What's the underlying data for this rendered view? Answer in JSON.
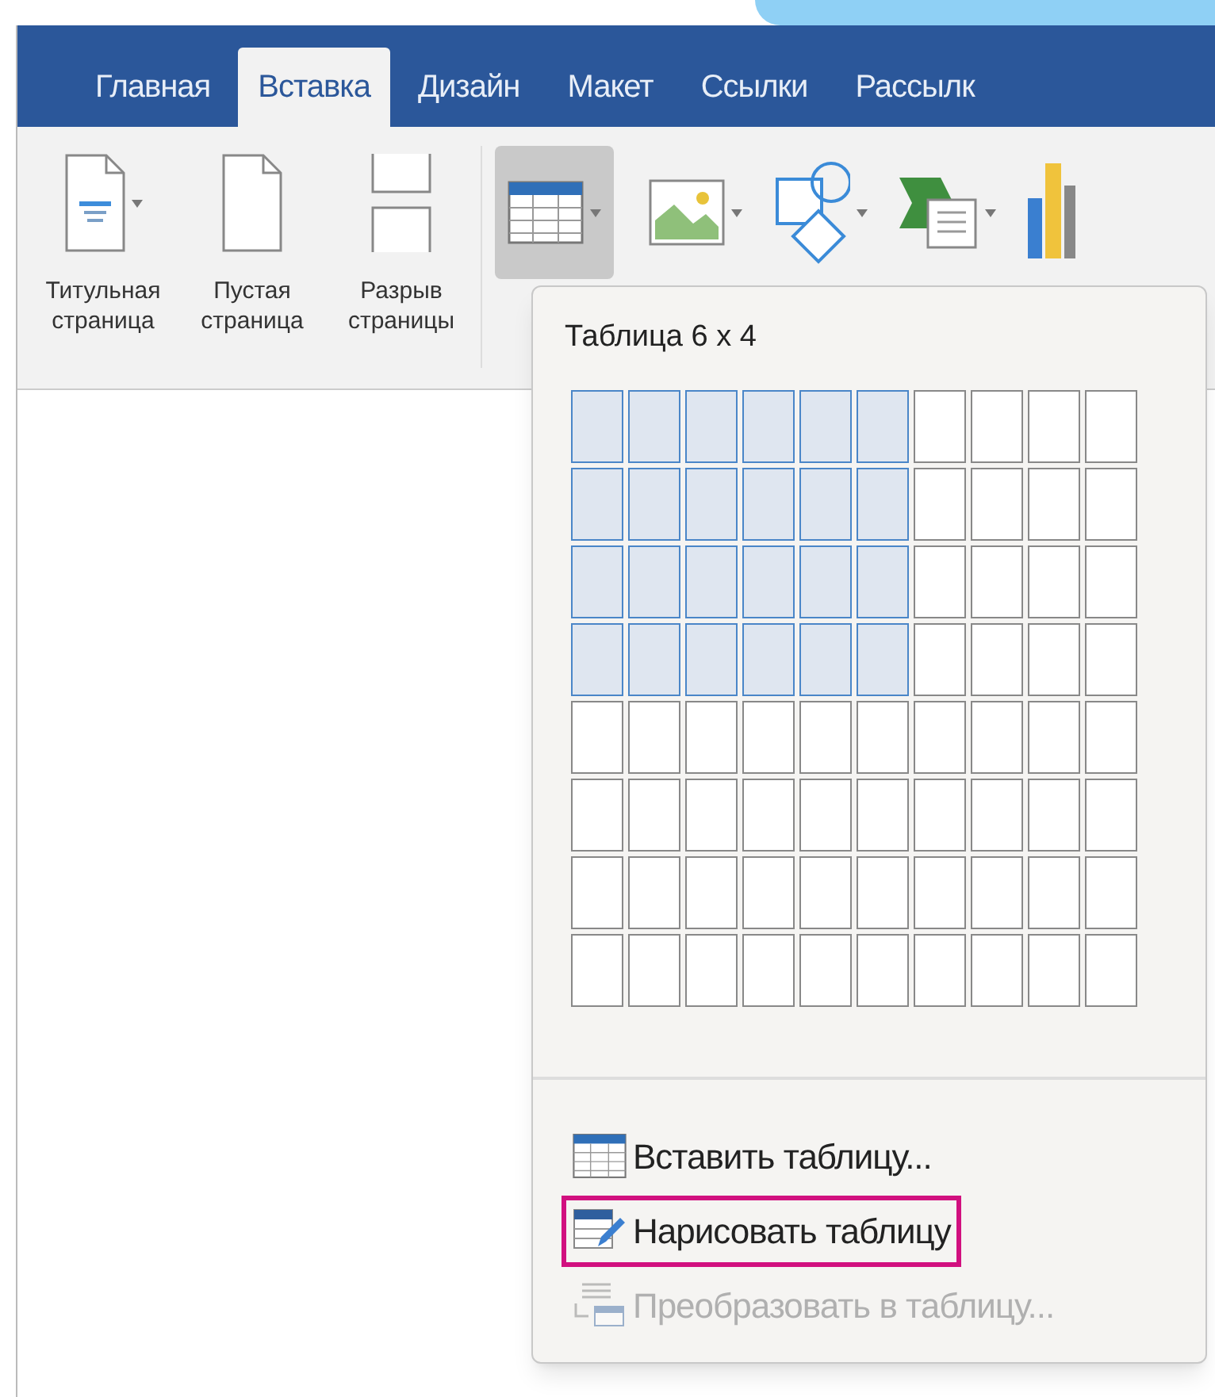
{
  "tabs": [
    {
      "label": "Главная",
      "selected": false
    },
    {
      "label": "Вставка",
      "selected": true
    },
    {
      "label": "Дизайн",
      "selected": false
    },
    {
      "label": "Макет",
      "selected": false
    },
    {
      "label": "Ссылки",
      "selected": false
    },
    {
      "label": "Рассылк",
      "selected": false
    }
  ],
  "ribbon": {
    "page_buttons": [
      {
        "kind": "cover",
        "line1": "Титульная",
        "line2": "страница",
        "dropdown": true
      },
      {
        "kind": "blank",
        "line1": "Пустая",
        "line2": "страница",
        "dropdown": false
      },
      {
        "kind": "break",
        "line1": "Разрыв",
        "line2": "страницы",
        "dropdown": false
      }
    ],
    "icon_buttons": [
      {
        "kind": "table",
        "selected": true,
        "dropdown": true
      },
      {
        "kind": "picture",
        "selected": false,
        "dropdown": true
      },
      {
        "kind": "shapes",
        "selected": false,
        "dropdown": true
      },
      {
        "kind": "smartart",
        "selected": false,
        "dropdown": true
      },
      {
        "kind": "chart",
        "selected": false,
        "dropdown": false
      }
    ]
  },
  "table_menu": {
    "title": "Таблица 6 x 4",
    "grid_rows": [
      {
        "cells": [
          {
            "selected": true
          },
          {
            "selected": true
          },
          {
            "selected": true
          },
          {
            "selected": true
          },
          {
            "selected": true
          },
          {
            "selected": true
          },
          {
            "selected": false
          },
          {
            "selected": false
          },
          {
            "selected": false
          },
          {
            "selected": false
          }
        ]
      },
      {
        "cells": [
          {
            "selected": true
          },
          {
            "selected": true
          },
          {
            "selected": true
          },
          {
            "selected": true
          },
          {
            "selected": true
          },
          {
            "selected": true
          },
          {
            "selected": false
          },
          {
            "selected": false
          },
          {
            "selected": false
          },
          {
            "selected": false
          }
        ]
      },
      {
        "cells": [
          {
            "selected": true
          },
          {
            "selected": true
          },
          {
            "selected": true
          },
          {
            "selected": true
          },
          {
            "selected": true
          },
          {
            "selected": true
          },
          {
            "selected": false
          },
          {
            "selected": false
          },
          {
            "selected": false
          },
          {
            "selected": false
          }
        ]
      },
      {
        "cells": [
          {
            "selected": true
          },
          {
            "selected": true
          },
          {
            "selected": true
          },
          {
            "selected": true
          },
          {
            "selected": true
          },
          {
            "selected": true
          },
          {
            "selected": false
          },
          {
            "selected": false
          },
          {
            "selected": false
          },
          {
            "selected": false
          }
        ]
      },
      {
        "cells": [
          {
            "selected": false
          },
          {
            "selected": false
          },
          {
            "selected": false
          },
          {
            "selected": false
          },
          {
            "selected": false
          },
          {
            "selected": false
          },
          {
            "selected": false
          },
          {
            "selected": false
          },
          {
            "selected": false
          },
          {
            "selected": false
          }
        ]
      },
      {
        "cells": [
          {
            "selected": false
          },
          {
            "selected": false
          },
          {
            "selected": false
          },
          {
            "selected": false
          },
          {
            "selected": false
          },
          {
            "selected": false
          },
          {
            "selected": false
          },
          {
            "selected": false
          },
          {
            "selected": false
          },
          {
            "selected": false
          }
        ]
      },
      {
        "cells": [
          {
            "selected": false
          },
          {
            "selected": false
          },
          {
            "selected": false
          },
          {
            "selected": false
          },
          {
            "selected": false
          },
          {
            "selected": false
          },
          {
            "selected": false
          },
          {
            "selected": false
          },
          {
            "selected": false
          },
          {
            "selected": false
          }
        ]
      },
      {
        "cells": [
          {
            "selected": false
          },
          {
            "selected": false
          },
          {
            "selected": false
          },
          {
            "selected": false
          },
          {
            "selected": false
          },
          {
            "selected": false
          },
          {
            "selected": false
          },
          {
            "selected": false
          },
          {
            "selected": false
          },
          {
            "selected": false
          }
        ]
      }
    ],
    "items": [
      {
        "kind": "insert",
        "label": "Вставить таблицу...",
        "disabled": false,
        "highlighted": false
      },
      {
        "kind": "draw",
        "label": "Нарисовать таблицу",
        "disabled": false,
        "highlighted": true
      },
      {
        "kind": "convert",
        "label": "Преобразовать в таблицу...",
        "disabled": true,
        "highlighted": false
      }
    ]
  }
}
